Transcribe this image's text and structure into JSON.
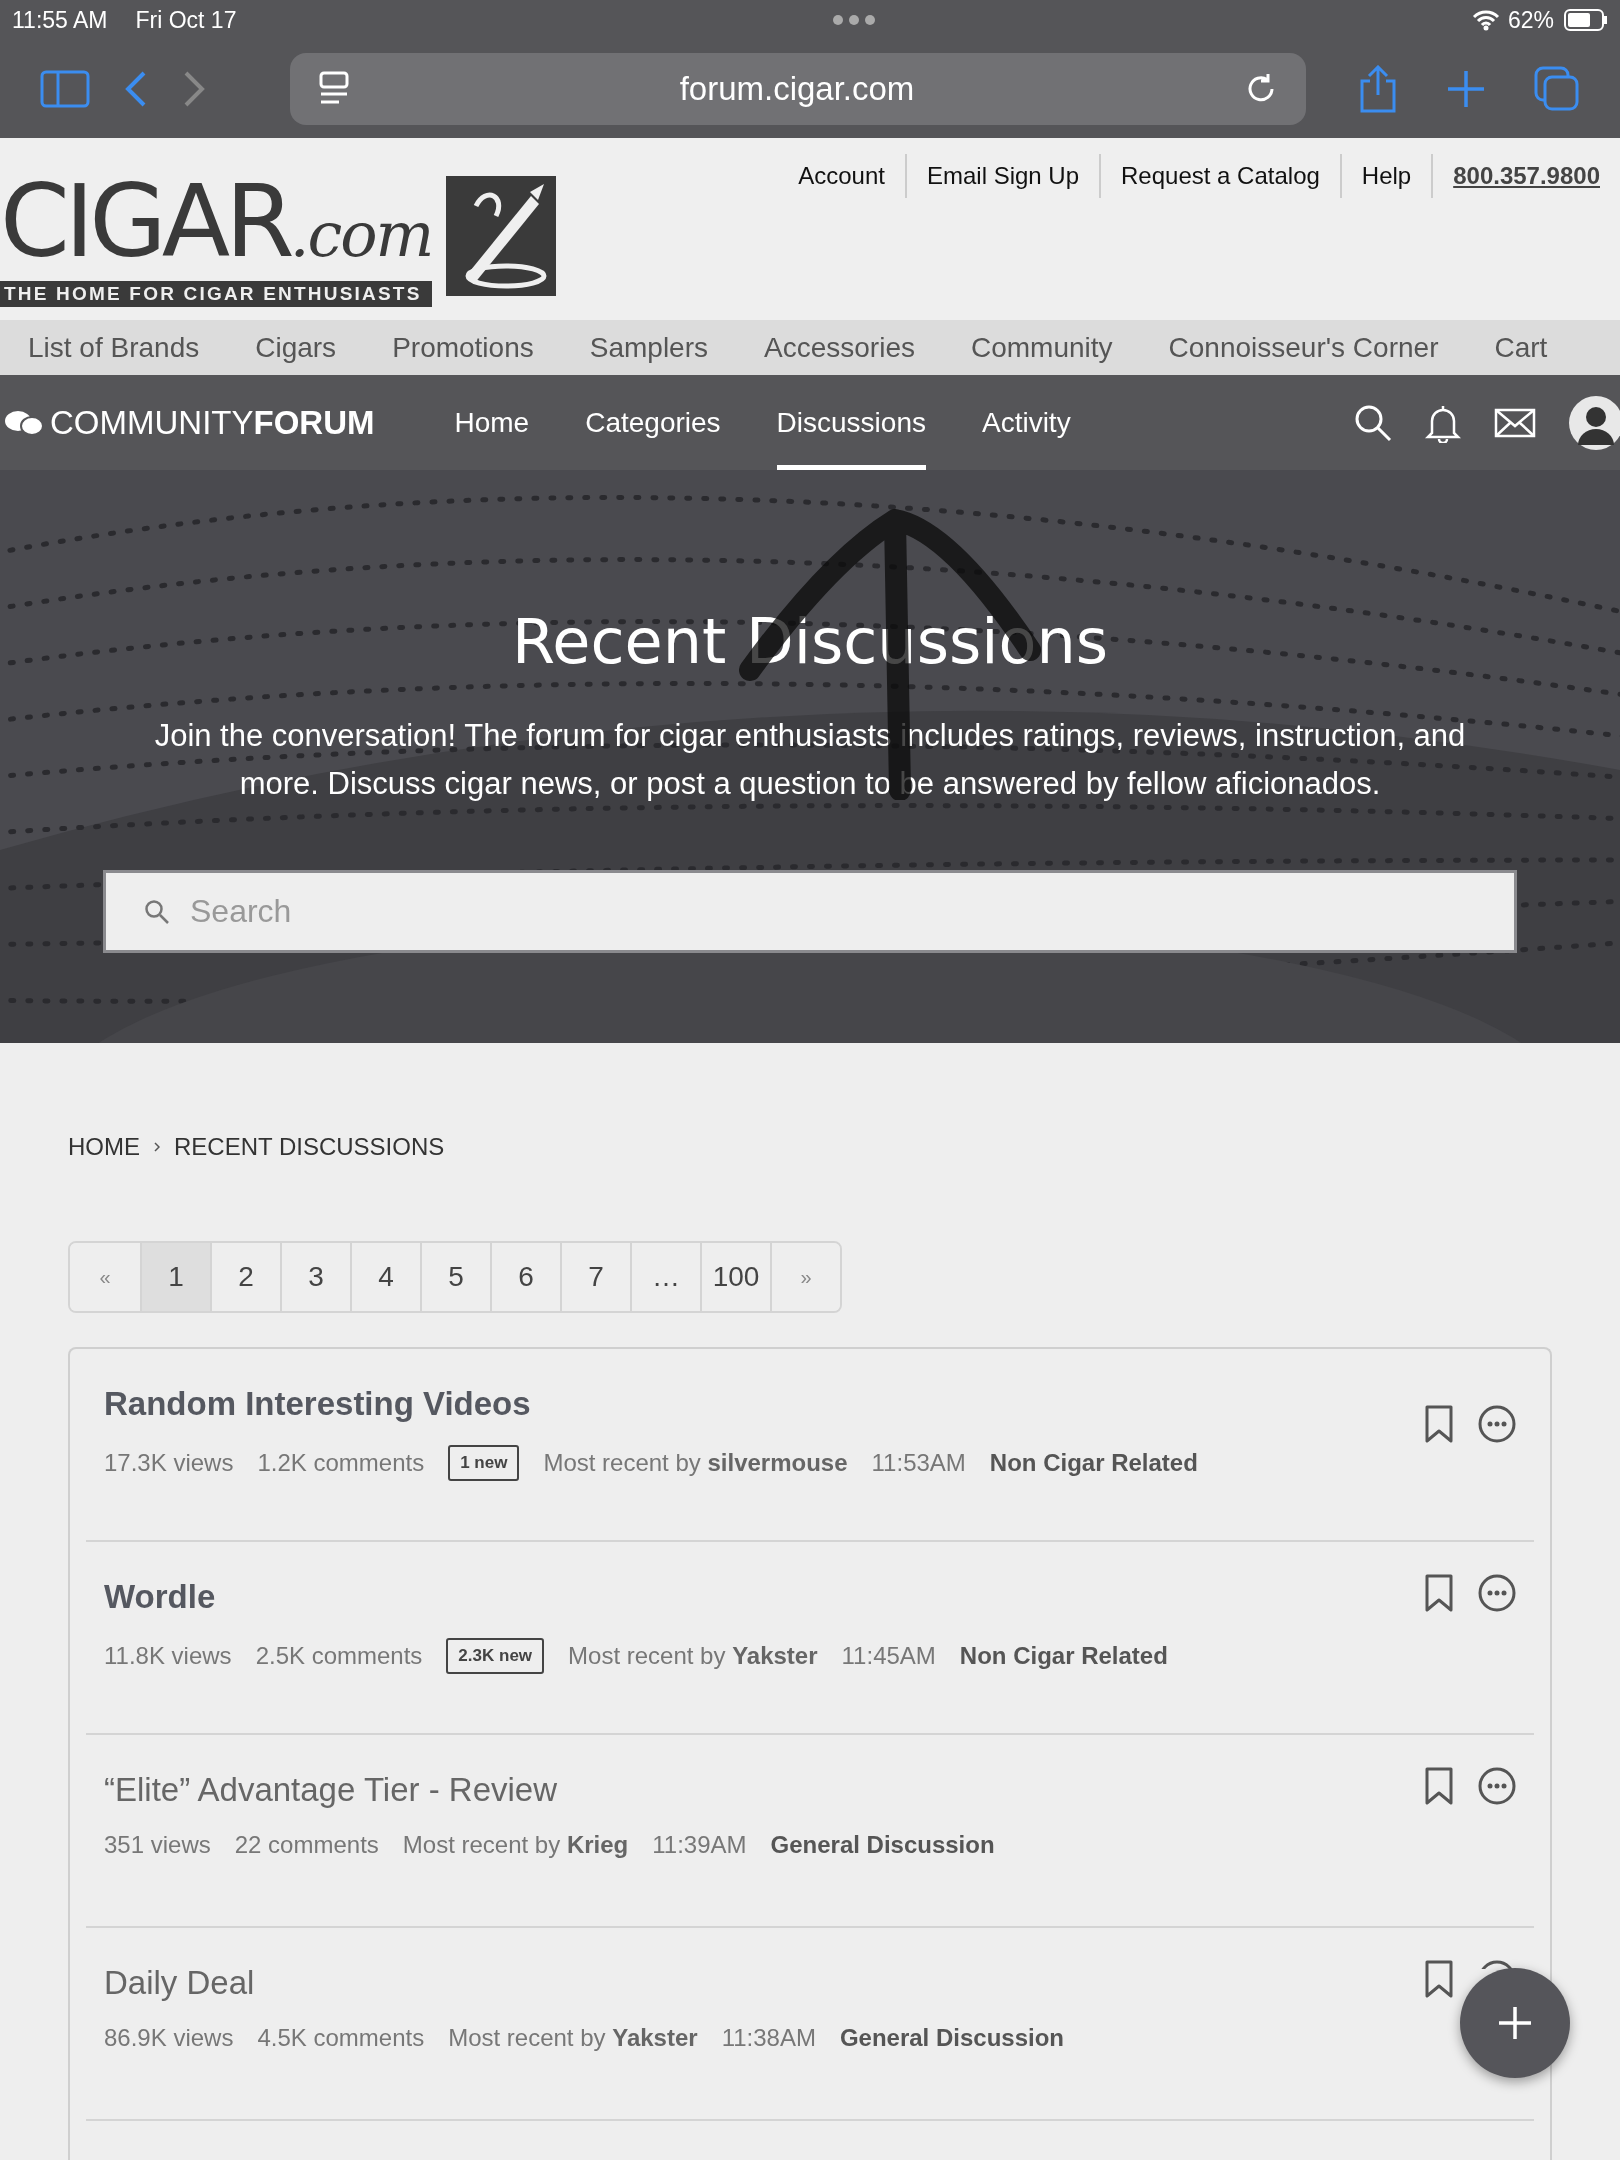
{
  "status_bar": {
    "time": "11:55 AM",
    "date": "Fri Oct 17",
    "battery": "62%"
  },
  "browser": {
    "url": "forum.cigar.com"
  },
  "utility_links": [
    {
      "label": "Account",
      "kind": "link"
    },
    {
      "label": "Email Sign Up",
      "kind": "link"
    },
    {
      "label": "Request a Catalog",
      "kind": "link"
    },
    {
      "label": "Help",
      "kind": "link"
    },
    {
      "label": "800.357.9800",
      "kind": "phone"
    }
  ],
  "logo": {
    "wordmark": "CIGAR",
    "suffix": ".com",
    "tagline": "THE HOME FOR CIGAR ENTHUSIASTS"
  },
  "main_nav": [
    "List of Brands",
    "Cigars",
    "Promotions",
    "Samplers",
    "Accessories",
    "Community",
    "Connoisseur's Corner",
    "Cart"
  ],
  "forum_nav": {
    "brand_light": "COMMUNITY",
    "brand_bold": "FORUM",
    "items": [
      {
        "label": "Home",
        "selected": false
      },
      {
        "label": "Categories",
        "selected": false
      },
      {
        "label": "Discussions",
        "selected": true
      },
      {
        "label": "Activity",
        "selected": false
      }
    ]
  },
  "hero": {
    "title": "Recent Discussions",
    "text": "Join the conversation! The forum for cigar enthusiasts includes ratings, reviews, instruction, and more. Discuss cigar news, or post a question to be answered by fellow aficionados.",
    "search_placeholder": "Search"
  },
  "breadcrumb": [
    "HOME",
    "RECENT DISCUSSIONS"
  ],
  "pagination": {
    "prev": "«",
    "next": "»",
    "pages": [
      {
        "label": "1",
        "selected": true
      },
      {
        "label": "2",
        "selected": false
      },
      {
        "label": "3",
        "selected": false
      },
      {
        "label": "4",
        "selected": false
      },
      {
        "label": "5",
        "selected": false
      },
      {
        "label": "6",
        "selected": false
      },
      {
        "label": "7",
        "selected": false
      },
      {
        "label": "…",
        "selected": false
      },
      {
        "label": "100",
        "selected": false
      }
    ]
  },
  "discussions": [
    {
      "title": "Random Interesting Videos",
      "unread": true,
      "views": "17.3K views",
      "comments": "1.2K comments",
      "new_badge": "1 new",
      "recent_prefix": "Most recent by",
      "recent_user": "silvermouse",
      "time": "11:53AM",
      "category": "Non Cigar Related"
    },
    {
      "title": "Wordle",
      "unread": true,
      "views": "11.8K views",
      "comments": "2.5K comments",
      "new_badge": "2.3K new",
      "recent_prefix": "Most recent by",
      "recent_user": "Yakster",
      "time": "11:45AM",
      "category": "Non Cigar Related"
    },
    {
      "title": "“Elite” Advantage Tier - Review",
      "unread": false,
      "views": "351 views",
      "comments": "22 comments",
      "recent_prefix": "Most recent by",
      "recent_user": "Krieg",
      "time": "11:39AM",
      "category": "General Discussion"
    },
    {
      "title": "Daily Deal",
      "unread": false,
      "views": "86.9K views",
      "comments": "4.5K comments",
      "recent_prefix": "Most recent by",
      "recent_user": "Yakster",
      "time": "11:38AM",
      "category": "General Discussion"
    }
  ]
}
